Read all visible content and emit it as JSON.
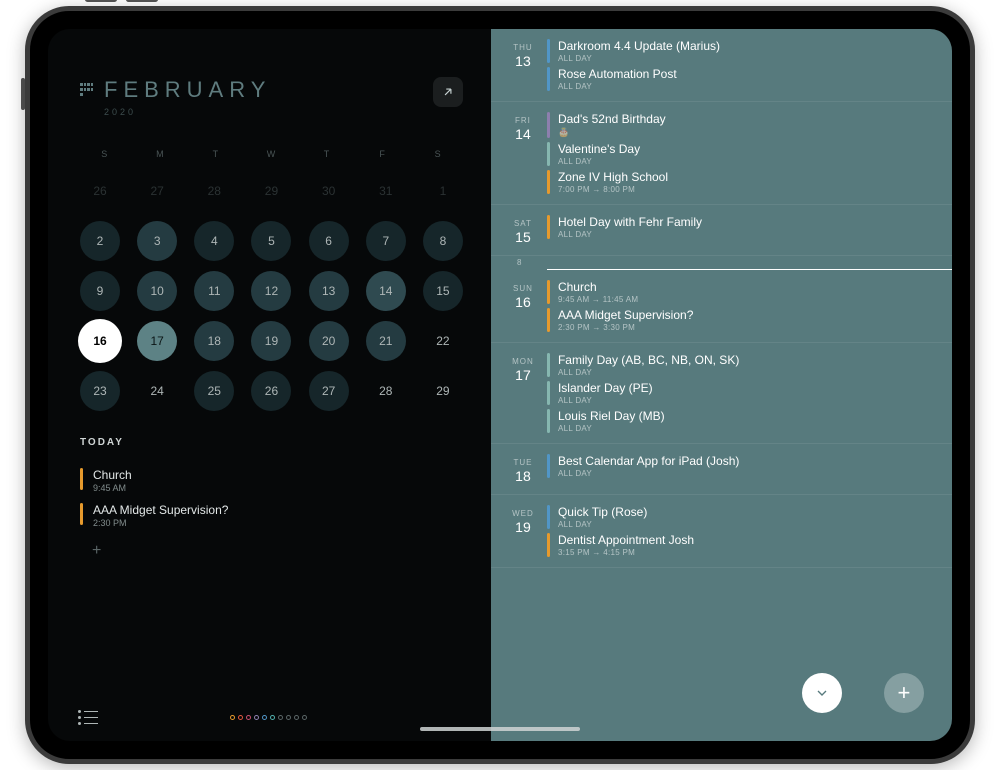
{
  "month": {
    "title": "FEBRUARY",
    "year": "2020"
  },
  "dow": [
    "S",
    "M",
    "T",
    "W",
    "T",
    "F",
    "S"
  ],
  "grid": [
    [
      {
        "n": "26",
        "cls": "ghost"
      },
      {
        "n": "27",
        "cls": "ghost"
      },
      {
        "n": "28",
        "cls": "ghost"
      },
      {
        "n": "29",
        "cls": "ghost"
      },
      {
        "n": "30",
        "cls": "ghost"
      },
      {
        "n": "31",
        "cls": "ghost"
      },
      {
        "n": "1",
        "cls": "ghost"
      }
    ],
    [
      {
        "n": "2",
        "cls": "dot-dark"
      },
      {
        "n": "3",
        "cls": "dot-med"
      },
      {
        "n": "4",
        "cls": "dot-dark"
      },
      {
        "n": "5",
        "cls": "dot-dark"
      },
      {
        "n": "6",
        "cls": "dot-dark"
      },
      {
        "n": "7",
        "cls": "dot-dark"
      },
      {
        "n": "8",
        "cls": "dot-dark"
      }
    ],
    [
      {
        "n": "9",
        "cls": "dot-dark"
      },
      {
        "n": "10",
        "cls": "dot-med"
      },
      {
        "n": "11",
        "cls": "dot-med"
      },
      {
        "n": "12",
        "cls": "dot-med"
      },
      {
        "n": "13",
        "cls": "dot-med"
      },
      {
        "n": "14",
        "cls": "dot-lt"
      },
      {
        "n": "15",
        "cls": "dot-dark"
      }
    ],
    [
      {
        "n": "16",
        "cls": "current ring"
      },
      {
        "n": "17",
        "cls": "selected"
      },
      {
        "n": "18",
        "cls": "dot-med"
      },
      {
        "n": "19",
        "cls": "dot-med"
      },
      {
        "n": "20",
        "cls": "dot-med"
      },
      {
        "n": "21",
        "cls": "dot-med"
      },
      {
        "n": "22",
        "cls": "empty"
      }
    ],
    [
      {
        "n": "23",
        "cls": "dot-dark"
      },
      {
        "n": "24",
        "cls": "empty"
      },
      {
        "n": "25",
        "cls": "dot-dark"
      },
      {
        "n": "26",
        "cls": "dot-dark"
      },
      {
        "n": "27",
        "cls": "dot-dark"
      },
      {
        "n": "28",
        "cls": "empty"
      },
      {
        "n": "29",
        "cls": "empty"
      }
    ]
  ],
  "today_label": "TODAY",
  "today_events": [
    {
      "bar": "orange",
      "ttl": "Church",
      "sub": "9:45 AM"
    },
    {
      "bar": "orange",
      "ttl": "AAA Midget Supervision?",
      "sub": "2:30 PM"
    }
  ],
  "week_marker": "8",
  "agenda": [
    {
      "wd": "THU",
      "dn": "13",
      "events": [
        {
          "bar": "blue",
          "ttl": "Darkroom 4.4 Update (Marius)",
          "sub": "ALL DAY"
        },
        {
          "bar": "blue",
          "ttl": "Rose Automation Post",
          "sub": "ALL DAY"
        }
      ]
    },
    {
      "wd": "FRI",
      "dn": "14",
      "events": [
        {
          "bar": "purple",
          "ttl": "Dad's 52nd Birthday",
          "sub": "",
          "cake": true
        },
        {
          "bar": "teal",
          "ttl": "Valentine's Day",
          "sub": "ALL DAY"
        },
        {
          "bar": "orange",
          "ttl": "Zone IV High School",
          "sub": "7:00 PM → 8:00 PM"
        }
      ]
    },
    {
      "wd": "SAT",
      "dn": "15",
      "events": [
        {
          "bar": "orange",
          "ttl": "Hotel Day with Fehr Family",
          "sub": "ALL DAY"
        }
      ]
    },
    {
      "wd": "SUN",
      "dn": "16",
      "events": [
        {
          "bar": "orange",
          "ttl": "Church",
          "sub": "9:45 AM → 11:45 AM"
        },
        {
          "bar": "orange",
          "ttl": "AAA Midget Supervision?",
          "sub": "2:30 PM → 3:30 PM"
        }
      ],
      "now": true
    },
    {
      "wd": "MON",
      "dn": "17",
      "events": [
        {
          "bar": "teal",
          "ttl": "Family Day (AB, BC, NB, ON, SK)",
          "sub": "ALL DAY"
        },
        {
          "bar": "teal",
          "ttl": "Islander Day (PE)",
          "sub": "ALL DAY"
        },
        {
          "bar": "teal",
          "ttl": "Louis Riel Day (MB)",
          "sub": "ALL DAY"
        }
      ]
    },
    {
      "wd": "TUE",
      "dn": "18",
      "events": [
        {
          "bar": "blue",
          "ttl": "Best Calendar App for iPad (Josh)",
          "sub": "ALL DAY"
        }
      ]
    },
    {
      "wd": "WED",
      "dn": "19",
      "events": [
        {
          "bar": "blue",
          "ttl": "Quick Tip (Rose)",
          "sub": "ALL DAY"
        },
        {
          "bar": "orange",
          "ttl": "Dentist Appointment Josh",
          "sub": "3:15 PM → 4:15 PM"
        }
      ]
    }
  ]
}
